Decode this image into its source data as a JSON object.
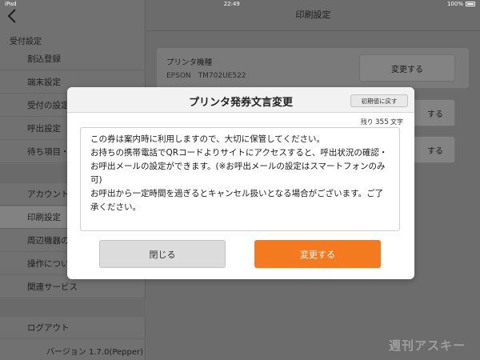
{
  "status_bar": {
    "device": "iPad",
    "time": "22:49",
    "battery": "100%"
  },
  "sidebar": {
    "section_label": "受付設定",
    "items": [
      {
        "label": "割込登録"
      },
      {
        "label": "端末設定"
      },
      {
        "label": "受付の設定"
      },
      {
        "label": "呼出設定"
      },
      {
        "label": "待ち項目・"
      },
      {
        "label": "アカウント"
      },
      {
        "label": "印刷設定",
        "active": true
      },
      {
        "label": "周辺機器の"
      },
      {
        "label": "操作につい"
      },
      {
        "label": "関連サービス"
      },
      {
        "label": "ログアウト"
      }
    ],
    "version": "バージョン 1.7.0(Pepper)"
  },
  "main": {
    "title": "印刷設定",
    "printer_label": "プリンタ機種",
    "printer_model": "EPSON　TM702UE522",
    "change_button": "変更する",
    "partial_buttons": [
      "する",
      "する"
    ]
  },
  "modal": {
    "title": "プリンタ発券文言変更",
    "reset_button": "初期値に戻す",
    "remaining_prefix": "残り",
    "remaining_count": "355",
    "remaining_suffix": "文字",
    "message": "この券は案内時に利用しますので、大切に保管してください。\nお持ちの携帯電話でQRコードよりサイトにアクセスすると、呼出状況の確認・お呼出メールの設定ができます。(※お呼出メールの設定はスマートフォンのみ可)\nお呼出から一定時間を過ぎるとキャンセル扱いとなる場合がございます。ご了承ください。",
    "close_button": "閉じる",
    "submit_button": "変更する"
  },
  "watermark": "週刊アスキー",
  "colors": {
    "accent": "#f47a1f",
    "overlay_bg": "#6f6f6f"
  }
}
